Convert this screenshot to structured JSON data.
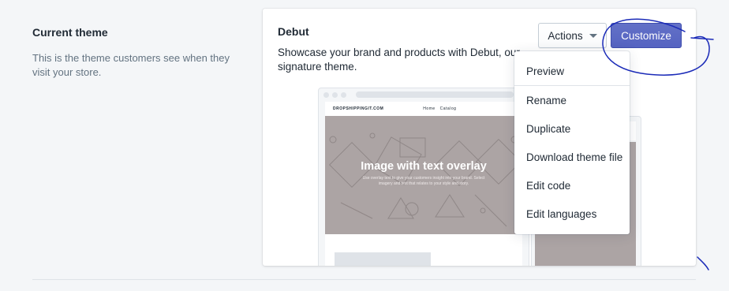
{
  "section": {
    "title": "Current theme",
    "description": "This is the theme customers see when they visit your store."
  },
  "theme": {
    "name": "Debut",
    "description": "Showcase your brand and products with Debut, our signature theme."
  },
  "buttons": {
    "actions_label": "Actions",
    "customize_label": "Customize"
  },
  "actions_menu": {
    "items": [
      "Preview",
      "Rename",
      "Duplicate",
      "Download theme file",
      "Edit code",
      "Edit languages"
    ]
  },
  "preview": {
    "store_name": "DROPSHIPPINGIT.COM",
    "nav_links": [
      "Home",
      "Catalog"
    ],
    "hero_title": "Image with text overlay",
    "hero_subtitle": "Use overlay text to give your customers insight into your brand. Select imagery and text that relates to your style and story."
  },
  "colors": {
    "primary": "#5c6ac4",
    "annotation": "#1b2bb8",
    "hero": "#aca4a4",
    "background": "#f4f6f8"
  },
  "icons": {
    "actions_caret": "caret-down-icon"
  }
}
